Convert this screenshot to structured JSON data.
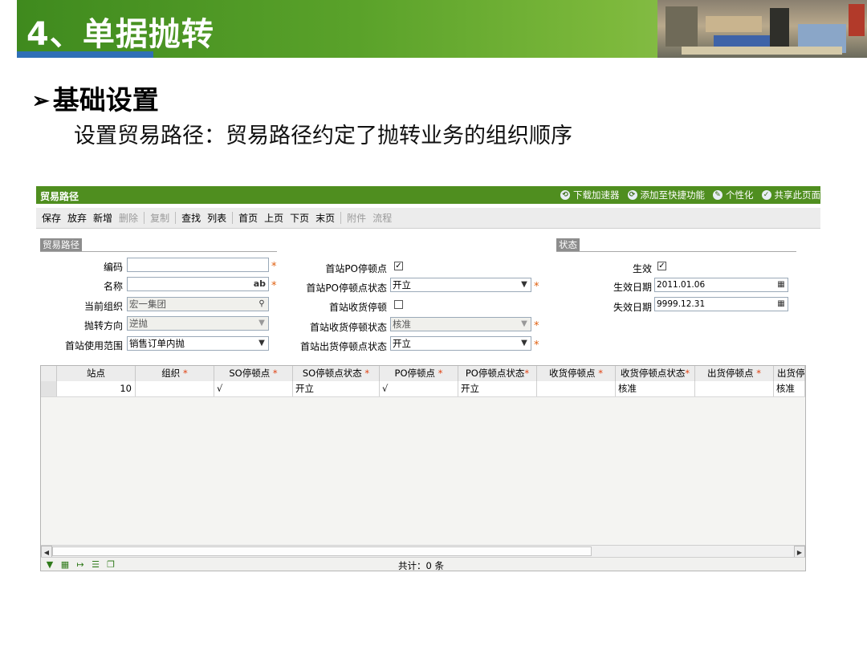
{
  "slide": {
    "title": "4、单据抛转",
    "bullet": "基础设置",
    "bullet_marker": "➢",
    "subtitle": "设置贸易路径：贸易路径约定了抛转业务的组织顺序"
  },
  "app": {
    "window_title": "贸易路径",
    "title_actions": [
      {
        "icon": "download-icon",
        "glyph": "⟲",
        "label": "下载加速器"
      },
      {
        "icon": "add-shortcut-icon",
        "glyph": "⟳",
        "label": "添加至快捷功能"
      },
      {
        "icon": "personalize-icon",
        "glyph": "✎",
        "label": "个性化"
      },
      {
        "icon": "share-icon",
        "glyph": "✓",
        "label": "共享此页面"
      }
    ],
    "toolbar": {
      "save": "保存",
      "discard": "放弃",
      "add": "新增",
      "delete": "删除",
      "copy": "复制",
      "find": "查找",
      "list": "列表",
      "first": "首页",
      "prev": "上页",
      "next": "下页",
      "last": "末页",
      "attach": "附件",
      "flow": "流程"
    },
    "sections": {
      "trade_path": "贸易路径",
      "status": "状态"
    },
    "form": {
      "code_label": "编码",
      "code_value": "",
      "name_label": "名称",
      "name_value": "",
      "name_badge": "ab",
      "org_label": "当前组织",
      "org_value": "宏一集团",
      "direction_label": "抛转方向",
      "direction_value": "逆抛",
      "scope_label": "首站使用范围",
      "scope_value": "销售订单内抛",
      "po_stop_label": "首站PO停顿点",
      "po_stop_checked": "✓",
      "po_state_label": "首站PO停顿点状态",
      "po_state_value": "开立",
      "recv_stop_label": "首站收货停顿",
      "recv_stop_checked": "",
      "recv_state_label": "首站收货停顿状态",
      "recv_state_value": "核准",
      "ship_state_label": "首站出货停顿点状态",
      "ship_state_value": "开立",
      "effective_label": "生效",
      "effective_checked": "✓",
      "eff_date_label": "生效日期",
      "eff_date_value": "2011.01.06",
      "exp_date_label": "失效日期",
      "exp_date_value": "9999.12.31"
    },
    "grid": {
      "columns": [
        {
          "label": "站点",
          "required": false
        },
        {
          "label": "组织",
          "required": true
        },
        {
          "label": "SO停顿点",
          "required": true
        },
        {
          "label": "SO停顿点状态",
          "required": true
        },
        {
          "label": "PO停顿点",
          "required": true
        },
        {
          "label": "PO停顿点状态",
          "required": true
        },
        {
          "label": "收货停顿点",
          "required": true
        },
        {
          "label": "收货停顿点状态",
          "required": true
        },
        {
          "label": "出货停顿点",
          "required": true
        },
        {
          "label": "出货停",
          "required": false
        }
      ],
      "rows": [
        [
          "10",
          "",
          "√",
          "开立",
          "√",
          "开立",
          "",
          "核准",
          "",
          "核准"
        ]
      ],
      "total": "共计：0 条"
    }
  }
}
